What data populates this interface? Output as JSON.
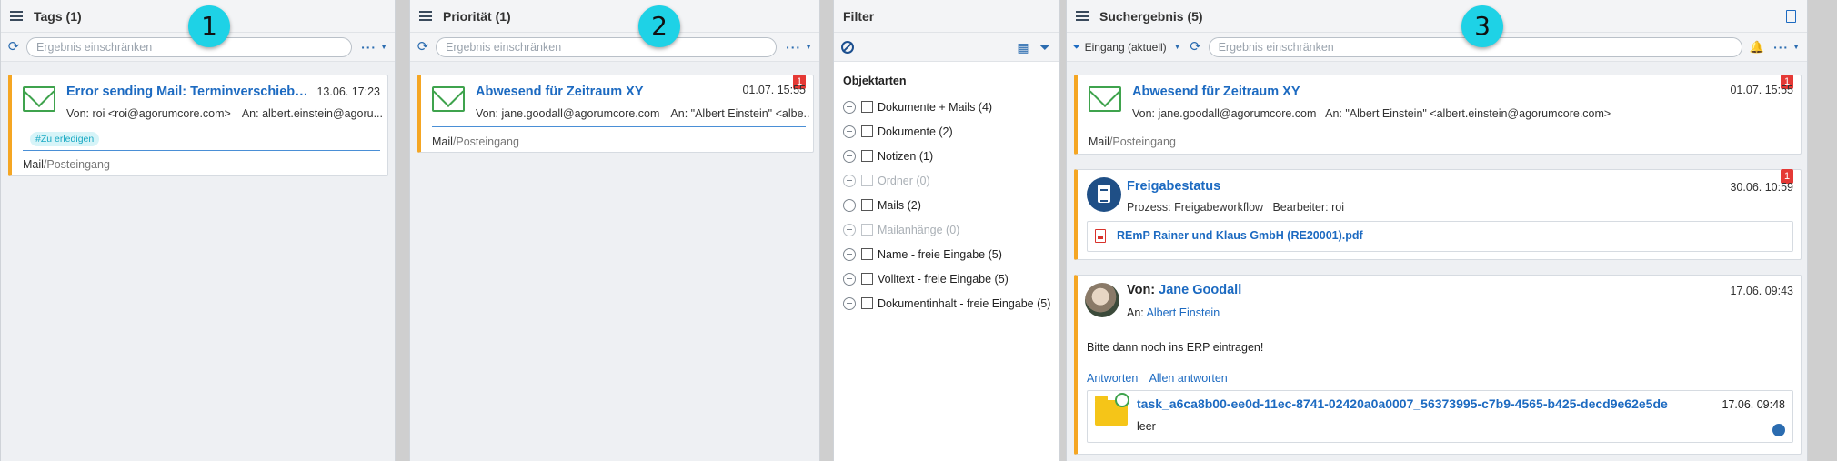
{
  "tags_panel": {
    "title": "Tags (1)",
    "search_placeholder": "Ergebnis einschränken",
    "more": "···",
    "step": "1",
    "card": {
      "title": "Error sending Mail: Terminverschiebu...",
      "date": "13.06. 17:23",
      "from": "Von: roi <roi@agorumcore.com>",
      "to": "An: albert.einstein@agoru...",
      "tag": "#Zu erledigen",
      "path_root": "Mail",
      "path_rest": "/Posteingang"
    }
  },
  "prio_panel": {
    "title": "Priorität (1)",
    "search_placeholder": "Ergebnis einschränken",
    "more": "···",
    "step": "2",
    "card": {
      "count": "1",
      "title": "Abwesend für Zeitraum XY",
      "date": "01.07. 15:55",
      "from": "Von: jane.goodall@agorumcore.com",
      "to": "An: \"Albert Einstein\" <albe...",
      "path_root": "Mail",
      "path_rest": "/Posteingang"
    }
  },
  "filter_panel": {
    "title": "Filter",
    "heading": "Objektarten",
    "items": [
      {
        "label": "Dokumente + Mails (4)",
        "disabled": false
      },
      {
        "label": "Dokumente (2)",
        "disabled": false
      },
      {
        "label": "Notizen (1)",
        "disabled": false
      },
      {
        "label": "Ordner (0)",
        "disabled": true
      },
      {
        "label": "Mails (2)",
        "disabled": false
      },
      {
        "label": "Mailanhänge (0)",
        "disabled": true
      },
      {
        "label": "Name - freie Eingabe (5)",
        "disabled": false
      },
      {
        "label": "Volltext - freie Eingabe (5)",
        "disabled": false
      },
      {
        "label": "Dokumentinhalt - freie Eingabe (5)",
        "disabled": false
      }
    ]
  },
  "result_panel": {
    "title": "Suchergebnis (5)",
    "inbox_label": "Eingang (aktuell)",
    "search_placeholder": "Ergebnis einschränken",
    "more": "···",
    "step": "3",
    "card1": {
      "count": "1",
      "title": "Abwesend für Zeitraum XY",
      "date": "01.07. 15:55",
      "meta": "Von: jane.goodall@agorumcore.com   An: \"Albert Einstein\" <albert.einstein@agorumcore.com>",
      "path_root": "Mail",
      "path_rest": "/Posteingang"
    },
    "card2": {
      "count": "1",
      "title": "Freigabestatus",
      "date": "30.06. 10:59",
      "meta": "Prozess: Freigabeworkflow   Bearbeiter: roi",
      "attachment": "REmP Rainer und Klaus GmbH (RE20001).pdf"
    },
    "card3": {
      "from_label": "Von:",
      "from_name": "Jane Goodall",
      "date": "17.06. 09:43",
      "to_label": "An:",
      "to_name": "Albert Einstein",
      "body": "Bitte dann noch ins ERP eintragen!",
      "reply": "Antworten",
      "reply_all": "Allen antworten",
      "task_title": "task_a6ca8b00-ee0d-11ec-8741-02420a0a0007_56373995-c7b9-4565-b425-decd9e62e5de",
      "task_date": "17.06. 09:48",
      "task_sub": "leer"
    }
  }
}
